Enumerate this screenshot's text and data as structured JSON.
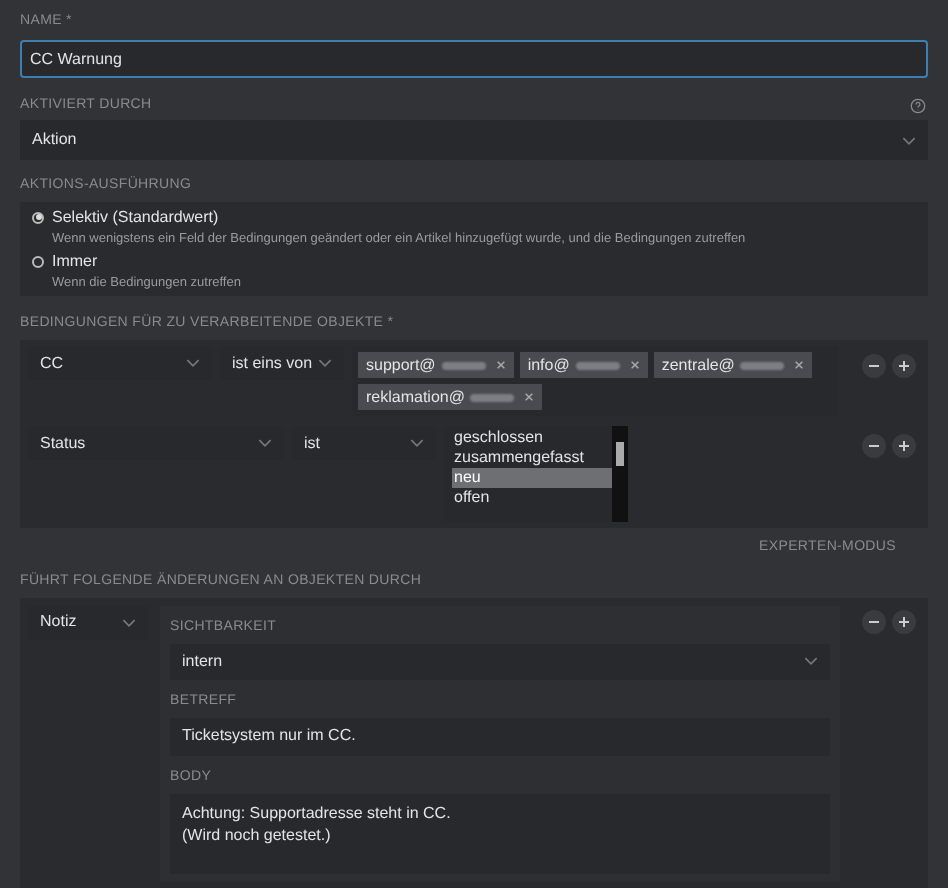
{
  "name_field": {
    "label": "NAME *",
    "value": "CC Warnung"
  },
  "activated_by": {
    "label": "AKTIVIERT DURCH",
    "value": "Aktion"
  },
  "execution": {
    "label": "AKTIONS-AUSFÜHRUNG",
    "options": [
      {
        "label": "Selektiv (Standardwert)",
        "description": "Wenn wenigstens ein Feld der Bedingungen geändert oder ein Artikel hinzugefügt wurde, und die Bedingungen zutreffen",
        "selected": true
      },
      {
        "label": "Immer",
        "description": "Wenn die Bedingungen zutreffen",
        "selected": false
      }
    ]
  },
  "conditions": {
    "label": "BEDINGUNGEN FÜR ZU VERARBEITENDE OBJEKTE *",
    "rows": [
      {
        "kind": "tags",
        "attribute": "CC",
        "operator": "ist eins von",
        "tags": [
          "support@",
          "info@",
          "zentrale@",
          "reklamation@"
        ]
      },
      {
        "kind": "list",
        "attribute": "Status",
        "operator": "ist",
        "options": [
          {
            "label": "geschlossen",
            "selected": false
          },
          {
            "label": "zusammengefasst",
            "selected": false
          },
          {
            "label": "neu",
            "selected": true
          },
          {
            "label": "offen",
            "selected": false
          }
        ]
      }
    ]
  },
  "expert_mode": "EXPERTEN-MODUS",
  "changes": {
    "label": "FÜHRT FOLGENDE ÄNDERUNGEN AN OBJEKTEN DURCH",
    "action": "Notiz",
    "visibility_label": "SICHTBARKEIT",
    "visibility": "intern",
    "subject_label": "BETREFF",
    "subject": "Ticketsystem nur im CC.",
    "body_label": "BODY",
    "body": [
      "Achtung: Supportadresse steht in CC.",
      "(Wird noch getestet.)"
    ]
  }
}
